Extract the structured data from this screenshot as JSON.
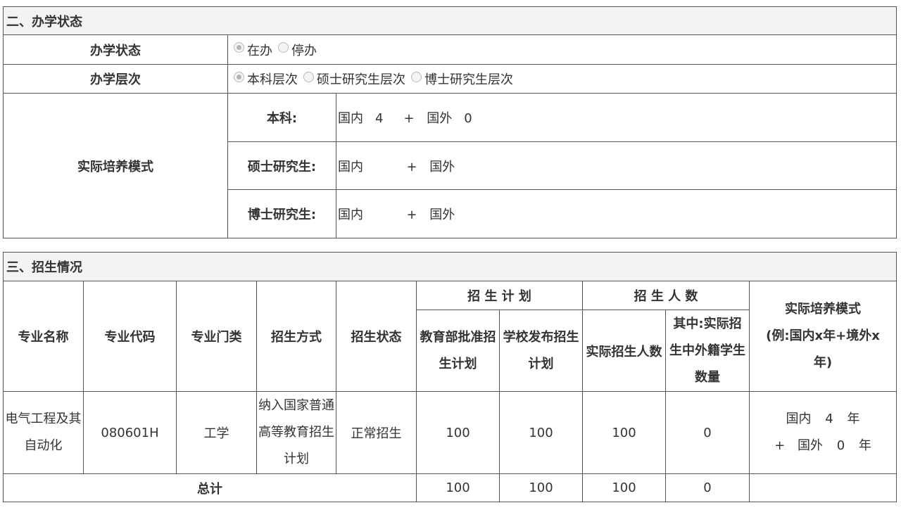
{
  "section2": {
    "title": "二、办学状态",
    "status_label": "办学状态",
    "status_options": [
      {
        "label": "在办",
        "checked": true
      },
      {
        "label": "停办",
        "checked": false
      }
    ],
    "level_label": "办学层次",
    "level_options": [
      {
        "label": "本科层次",
        "checked": true
      },
      {
        "label": "硕士研究生层次",
        "checked": false
      },
      {
        "label": "博士研究生层次",
        "checked": false
      }
    ],
    "mode_label": "实际培养模式",
    "mode_rows": [
      {
        "label": "本科:",
        "domestic": "国内",
        "domestic_val": "4",
        "plus": "+",
        "foreign": "国外",
        "foreign_val": "0"
      },
      {
        "label": "硕士研究生:",
        "domestic": "国内",
        "domestic_val": "",
        "plus": "+",
        "foreign": "国外",
        "foreign_val": ""
      },
      {
        "label": "博士研究生:",
        "domestic": "国内",
        "domestic_val": "",
        "plus": "+",
        "foreign": "国外",
        "foreign_val": ""
      }
    ]
  },
  "section3": {
    "title": "三、招生情况",
    "headers": {
      "major_name": "专业名称",
      "major_code": "专业代码",
      "category": "专业门类",
      "method": "招生方式",
      "status": "招生状态",
      "plan_group": "招 生 计 划",
      "plan_moe_1": "教育部批准招",
      "plan_moe_2": "生计划",
      "plan_school_1": "学校发布招生",
      "plan_school_2": "计划",
      "count_group": "招 生 人 数",
      "count_actual": "实际招生人数",
      "count_foreign_1": "其中:实际招",
      "count_foreign_2": "生中外籍学生",
      "count_foreign_3": "数量",
      "mode_1": "实际培养模式",
      "mode_2": "(例:国内x年+境外x",
      "mode_3": "年)"
    },
    "row": {
      "name_1": "电气工程及其",
      "name_2": "自动化",
      "code": "080601H",
      "category": "工学",
      "method_1": "纳入国家普通",
      "method_2": "高等教育招生",
      "method_3": "计划",
      "status": "正常招生",
      "plan_moe": "100",
      "plan_school": "100",
      "count_actual": "100",
      "count_foreign": "0",
      "mode_domestic": "国内",
      "mode_domestic_val": "4",
      "mode_year1": "年",
      "mode_plus": "+",
      "mode_foreign": "国外",
      "mode_foreign_val": "0",
      "mode_year2": "年"
    },
    "total": {
      "label": "总计",
      "plan_moe": "100",
      "plan_school": "100",
      "count_actual": "100",
      "count_foreign": "0"
    }
  }
}
